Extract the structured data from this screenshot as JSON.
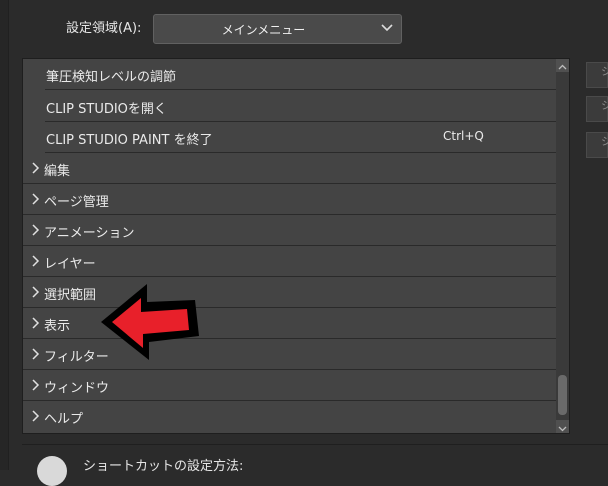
{
  "header": {
    "area_label": "設定領域(A):",
    "area_value": "メインメニュー"
  },
  "list": {
    "sub_items": [
      {
        "label": "筆圧検知レベルの調節",
        "shortcut": ""
      },
      {
        "label": "CLIP STUDIOを開く",
        "shortcut": ""
      },
      {
        "label": "CLIP STUDIO PAINT を終了",
        "shortcut": "Ctrl+Q"
      }
    ],
    "categories": [
      {
        "label": "編集"
      },
      {
        "label": "ページ管理"
      },
      {
        "label": "アニメーション"
      },
      {
        "label": "レイヤー"
      },
      {
        "label": "選択範囲"
      },
      {
        "label": "表示"
      },
      {
        "label": "フィルター"
      },
      {
        "label": "ウィンドウ"
      },
      {
        "label": "ヘルプ"
      }
    ]
  },
  "side_buttons": [
    "シ",
    "シ",
    "シ"
  ],
  "footer": {
    "hint": "ショートカットの設定方法:"
  },
  "colors": {
    "annotation_arrow": "#e8202a"
  }
}
